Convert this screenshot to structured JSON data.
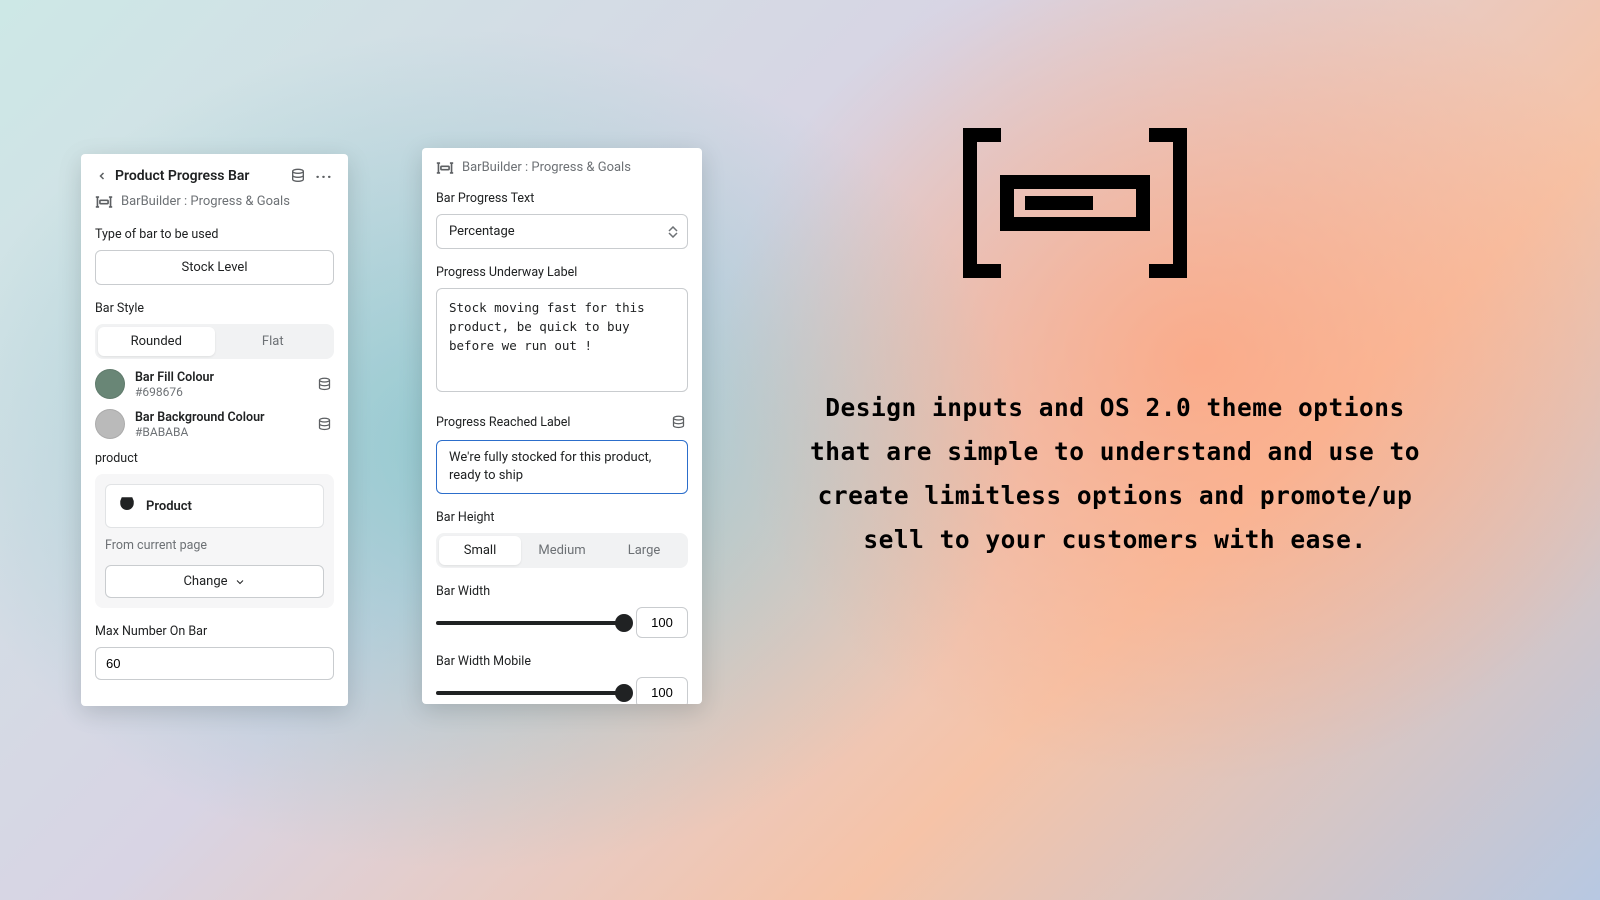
{
  "panelA": {
    "title": "Product Progress Bar",
    "subtitle": "BarBuilder : Progress & Goals",
    "type_label": "Type of bar to be used",
    "type_value": "Stock Level",
    "barstyle_label": "Bar Style",
    "barstyle_opts": {
      "rounded": "Rounded",
      "flat": "Flat"
    },
    "fill": {
      "name": "Bar Fill Colour",
      "hex": "#698676"
    },
    "bg": {
      "name": "Bar Background Colour",
      "hex": "#BABABA"
    },
    "product_label": "product",
    "product_name": "Product",
    "product_caption": "From current page",
    "change_label": "Change",
    "max_label": "Max Number On Bar",
    "max_value": "60"
  },
  "panelB": {
    "subtitle": "BarBuilder : Progress & Goals",
    "progress_text_label": "Bar Progress Text",
    "progress_text_value": "Percentage",
    "underway_label": "Progress Underway Label",
    "underway_value": "Stock moving fast for this product, be quick to buy before we run out !",
    "reached_label": "Progress Reached Label",
    "reached_value": "We're fully stocked for this product, ready to ship",
    "height_label": "Bar Height",
    "height_opts": {
      "small": "Small",
      "medium": "Medium",
      "large": "Large"
    },
    "width_label": "Bar Width",
    "width_value": "100",
    "width_mobile_label": "Bar Width Mobile",
    "width_mobile_value": "100"
  },
  "marketing_copy": "Design inputs and OS 2.0 theme options that are simple to understand and use to create limitless options and promote/up sell to your customers with ease."
}
